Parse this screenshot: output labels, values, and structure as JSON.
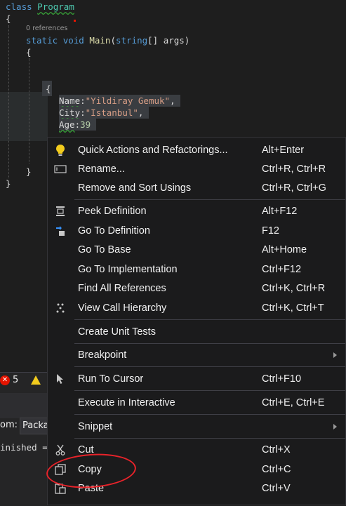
{
  "code": {
    "line1_kw": "class",
    "line1_type": "Program",
    "line2": "{",
    "references": "0 references",
    "line3_kw1": "static",
    "line3_kw2": "void",
    "line3_meth": "Main",
    "line3_paren_open": "(",
    "line3_kw3": "string",
    "line3_rest": "[] args)",
    "line4": "{",
    "brace_open": "{",
    "name_prop": "Name",
    "name_colon": ":",
    "name_val": "\"Yildiray Gemuk\"",
    "name_comma": ",",
    "city_prop": "City",
    "city_colon": ":",
    "city_val": "\"Istanbul\"",
    "city_comma": ",",
    "age_prop": "Age",
    "age_colon": ":",
    "age_val": "39",
    "brace_close_inner": "}",
    "brace_close_outer": "}"
  },
  "error_list": {
    "error_count": "5"
  },
  "output_panel": {
    "from_label": "om:",
    "from_value": "Packa",
    "text": "inished ="
  },
  "context_menu": {
    "items": [
      {
        "label": "Quick Actions and Refactorings...",
        "shortcut": "Alt+Enter",
        "icon": "lightbulb-icon"
      },
      {
        "label": "Rename...",
        "shortcut": "Ctrl+R, Ctrl+R",
        "icon": "rename-icon"
      },
      {
        "label": "Remove and Sort Usings",
        "shortcut": "Ctrl+R, Ctrl+G",
        "icon": ""
      },
      {
        "label": "Peek Definition",
        "shortcut": "Alt+F12",
        "icon": "peek-definition-icon"
      },
      {
        "label": "Go To Definition",
        "shortcut": "F12",
        "icon": "go-to-definition-icon"
      },
      {
        "label": "Go To Base",
        "shortcut": "Alt+Home",
        "icon": ""
      },
      {
        "label": "Go To Implementation",
        "shortcut": "Ctrl+F12",
        "icon": ""
      },
      {
        "label": "Find All References",
        "shortcut": "Ctrl+K, Ctrl+R",
        "icon": ""
      },
      {
        "label": "View Call Hierarchy",
        "shortcut": "Ctrl+K, Ctrl+T",
        "icon": "call-hierarchy-icon"
      },
      {
        "label": "Create Unit Tests",
        "shortcut": "",
        "icon": ""
      },
      {
        "label": "Breakpoint",
        "shortcut": "",
        "icon": "",
        "submenu": true
      },
      {
        "label": "Run To Cursor",
        "shortcut": "Ctrl+F10",
        "icon": "cursor-icon"
      },
      {
        "label": "Execute in Interactive",
        "shortcut": "Ctrl+E, Ctrl+E",
        "icon": ""
      },
      {
        "label": "Snippet",
        "shortcut": "",
        "icon": "",
        "submenu": true
      },
      {
        "label": "Cut",
        "shortcut": "Ctrl+X",
        "icon": "scissors-icon"
      },
      {
        "label": "Copy",
        "shortcut": "Ctrl+C",
        "icon": "copy-icon"
      },
      {
        "label": "Paste",
        "shortcut": "Ctrl+V",
        "icon": "paste-icon"
      }
    ]
  },
  "colors": {
    "background": "#1e1e1e",
    "menu_bg": "#1b1b1c",
    "keyword": "#569cd6",
    "type": "#4ec9b0",
    "string": "#d69d85",
    "annotation_circle": "#e8232a"
  }
}
